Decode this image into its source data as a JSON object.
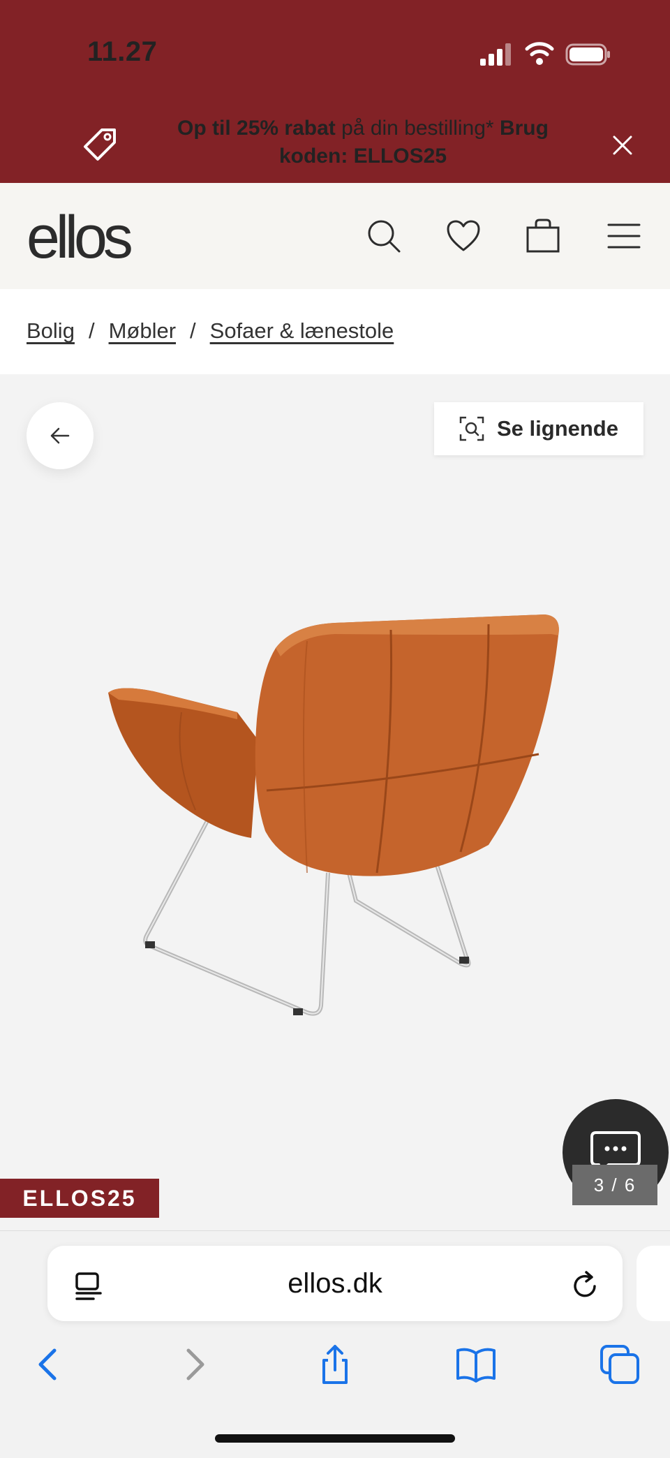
{
  "status_bar": {
    "time": "11.27"
  },
  "promo": {
    "text_bold_1": "Op til 25% rabat",
    "text_regular": " på din bestilling*",
    "text_bold_2": " Brug koden: ELLOS25"
  },
  "header": {
    "logo": "ellos"
  },
  "breadcrumb": {
    "items": [
      "Bolig",
      "Møbler",
      "Sofaer & lænestole"
    ],
    "separator": "/"
  },
  "gallery": {
    "similar_label": "Se lignende",
    "counter": "3 / 6",
    "promo_badge": "ELLOS25",
    "product_color": "#c5642c"
  },
  "browser": {
    "url": "ellos.dk",
    "accent": "#1a73e8"
  },
  "colors": {
    "brand": "#822226",
    "header_bg": "#f6f5f2"
  }
}
